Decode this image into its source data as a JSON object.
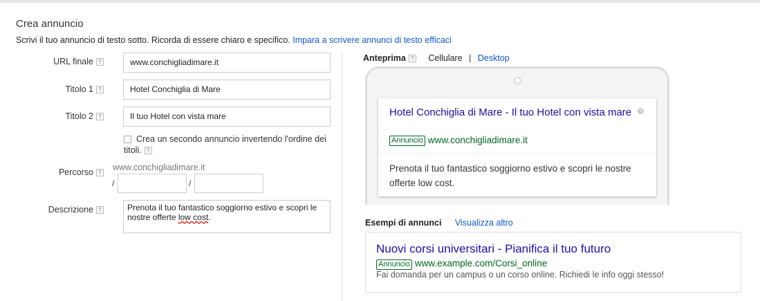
{
  "form": {
    "title": "Crea annuncio",
    "subtitle": "Scrivi il tuo annuncio di testo sotto. Ricorda di essere chiaro e specifico.",
    "subtitle_link": "Impara a scrivere annunci di testo efficaci",
    "help_glyph": "?",
    "final_url": {
      "label": "URL finale",
      "value": "www.conchigliadimare.it"
    },
    "headline1": {
      "label": "Titolo 1",
      "value": "Hotel Conchiglia di Mare"
    },
    "headline2": {
      "label": "Titolo 2",
      "value": "Il tuo Hotel con vista mare"
    },
    "swap_checkbox": {
      "label": "Crea un secondo annuncio invertendo l'ordine dei titoli.",
      "checked": false
    },
    "path": {
      "label": "Percorso",
      "domain": "www.conchigliadimare.it",
      "separator": "/",
      "path1": "",
      "path2": ""
    },
    "description": {
      "label": "Descrizione",
      "value_part1": "Prenota il tuo fantastico soggiorno estivo e scopri le nostre offerte ",
      "value_part2": "low cost",
      "value_part3": "."
    }
  },
  "preview": {
    "label": "Anteprima",
    "tab_mobile": "Cellulare",
    "tab_sep": "|",
    "tab_desktop": "Desktop",
    "ad": {
      "headline": "Hotel Conchiglia di Mare - Il tuo Hotel con vista mare",
      "badge": "Annuncio",
      "display_url": "www.conchigliadimare.it",
      "description": "Prenota il tuo fantastico soggiorno estivo e scopri le nostre offerte low cost."
    }
  },
  "examples": {
    "label": "Esempi di annunci",
    "link": "Visualizza altro",
    "ad": {
      "headline": "Nuovi corsi universitari - Pianifica il tuo futuro",
      "badge": "Annuncio",
      "display_url": "www.example.com/Corsi_online",
      "description": "Fai domanda per un campus o un corso online. Richiedi le info oggi stesso!"
    }
  },
  "colors": {
    "link": "#1155cc",
    "ad_title": "#1a0dab",
    "ad_url": "#006621"
  }
}
